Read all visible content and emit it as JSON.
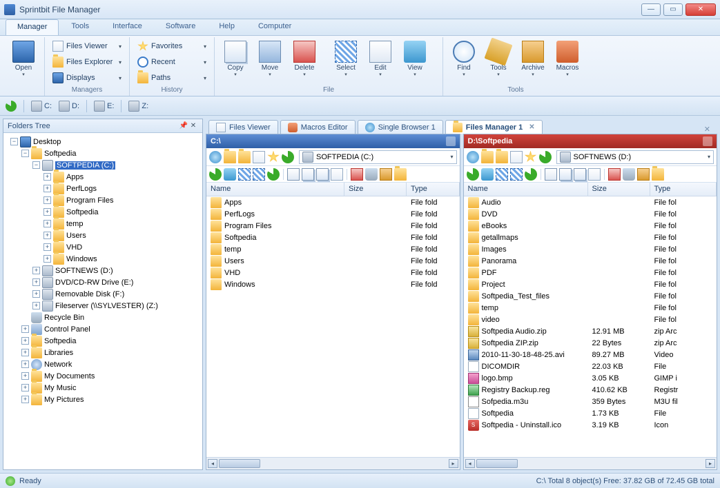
{
  "app": {
    "title": "Sprintbit File Manager"
  },
  "ribbon": {
    "tabs": [
      "Manager",
      "Tools",
      "Interface",
      "Software",
      "Help",
      "Computer"
    ],
    "active": 0,
    "groups": {
      "open": "Open",
      "managers": {
        "label": "Managers",
        "items": [
          "Files Viewer",
          "Files Explorer",
          "Displays"
        ]
      },
      "history": {
        "label": "History",
        "items": [
          "Favorites",
          "Recent",
          "Paths"
        ]
      },
      "file": {
        "label": "File",
        "btns": [
          "Copy",
          "Move",
          "Delete",
          "Select",
          "Edit",
          "View"
        ]
      },
      "tools": {
        "label": "Tools",
        "btns": [
          "Find",
          "Tools",
          "Archive",
          "Macros"
        ]
      }
    }
  },
  "drives_bar": [
    "C:",
    "D:",
    "E:",
    "Z:"
  ],
  "folders_panel": {
    "title": "Folders Tree"
  },
  "tree": {
    "root": "Desktop",
    "softpedia": "Softpedia",
    "c": "SOFTPEDIA (C:)",
    "c_children": [
      "Apps",
      "PerfLogs",
      "Program Files",
      "Softpedia",
      "temp",
      "Users",
      "VHD",
      "Windows"
    ],
    "d": "SOFTNEWS (D:)",
    "e": "DVD/CD-RW Drive (E:)",
    "f": "Removable Disk (F:)",
    "z": "Fileserver (\\\\SYLVESTER) (Z:)",
    "recycle": "Recycle Bin",
    "cp": "Control Panel",
    "soft2": "Softpedia",
    "lib": "Libraries",
    "net": "Network",
    "docs": "My Documents",
    "music": "My Music",
    "pics": "My Pictures"
  },
  "doc_tabs": [
    "Files Viewer",
    "Macros Editor",
    "Single Browser 1",
    "Files Manager 1"
  ],
  "doc_active": 3,
  "pane_left": {
    "path": "C:\\",
    "drive": "SOFTPEDIA (C:)",
    "cols": [
      "Name",
      "Size",
      "Type"
    ],
    "rows": [
      {
        "n": "Apps",
        "s": "",
        "t": "File fold"
      },
      {
        "n": "PerfLogs",
        "s": "",
        "t": "File fold"
      },
      {
        "n": "Program Files",
        "s": "",
        "t": "File fold"
      },
      {
        "n": "Softpedia",
        "s": "",
        "t": "File fold"
      },
      {
        "n": "temp",
        "s": "",
        "t": "File fold"
      },
      {
        "n": "Users",
        "s": "",
        "t": "File fold"
      },
      {
        "n": "VHD",
        "s": "",
        "t": "File fold"
      },
      {
        "n": "Windows",
        "s": "",
        "t": "File fold"
      }
    ]
  },
  "pane_right": {
    "path": "D:\\Softpedia",
    "drive": "SOFTNEWS (D:)",
    "cols": [
      "Name",
      "Size",
      "Type"
    ],
    "rows": [
      {
        "ic": "folder",
        "n": "Audio",
        "s": "",
        "t": "File fol"
      },
      {
        "ic": "folder",
        "n": "DVD",
        "s": "",
        "t": "File fol"
      },
      {
        "ic": "folder",
        "n": "eBooks",
        "s": "",
        "t": "File fol"
      },
      {
        "ic": "folder",
        "n": "getallmaps",
        "s": "",
        "t": "File fol"
      },
      {
        "ic": "folder",
        "n": "Images",
        "s": "",
        "t": "File fol"
      },
      {
        "ic": "folder",
        "n": "Panorama",
        "s": "",
        "t": "File fol"
      },
      {
        "ic": "folder",
        "n": "PDF",
        "s": "",
        "t": "File fol"
      },
      {
        "ic": "folder",
        "n": "Project",
        "s": "",
        "t": "File fol"
      },
      {
        "ic": "folder",
        "n": "Softpedia_Test_files",
        "s": "",
        "t": "File fol"
      },
      {
        "ic": "folder",
        "n": "temp",
        "s": "",
        "t": "File fol"
      },
      {
        "ic": "folder",
        "n": "video",
        "s": "",
        "t": "File fol"
      },
      {
        "ic": "zip",
        "n": "Softpedia Audio.zip",
        "s": "12.91 MB",
        "t": "zip Arc"
      },
      {
        "ic": "zip",
        "n": "Softpedia ZIP.zip",
        "s": "22 Bytes",
        "t": "zip Arc"
      },
      {
        "ic": "video",
        "n": "2010-11-30-18-48-25.avi",
        "s": "89.27 MB",
        "t": "Video"
      },
      {
        "ic": "file",
        "n": "DICOMDIR",
        "s": "22.03 KB",
        "t": "File"
      },
      {
        "ic": "bmp",
        "n": "logo.bmp",
        "s": "3.05 KB",
        "t": "GIMP i"
      },
      {
        "ic": "reg",
        "n": "Registry Backup.reg",
        "s": "410.62 KB",
        "t": "Registr"
      },
      {
        "ic": "m3u",
        "n": "Sofpedia.m3u",
        "s": "359 Bytes",
        "t": "M3U fil"
      },
      {
        "ic": "file",
        "n": "Softpedia",
        "s": "1.73 KB",
        "t": "File"
      },
      {
        "ic": "ico",
        "n": "Softpedia - Uninstall.ico",
        "s": "3.19 KB",
        "t": "Icon"
      }
    ]
  },
  "status": {
    "ready": "Ready",
    "right": "C:\\ Total 8 object(s) Free: 37.82 GB of 72.45 GB total"
  }
}
